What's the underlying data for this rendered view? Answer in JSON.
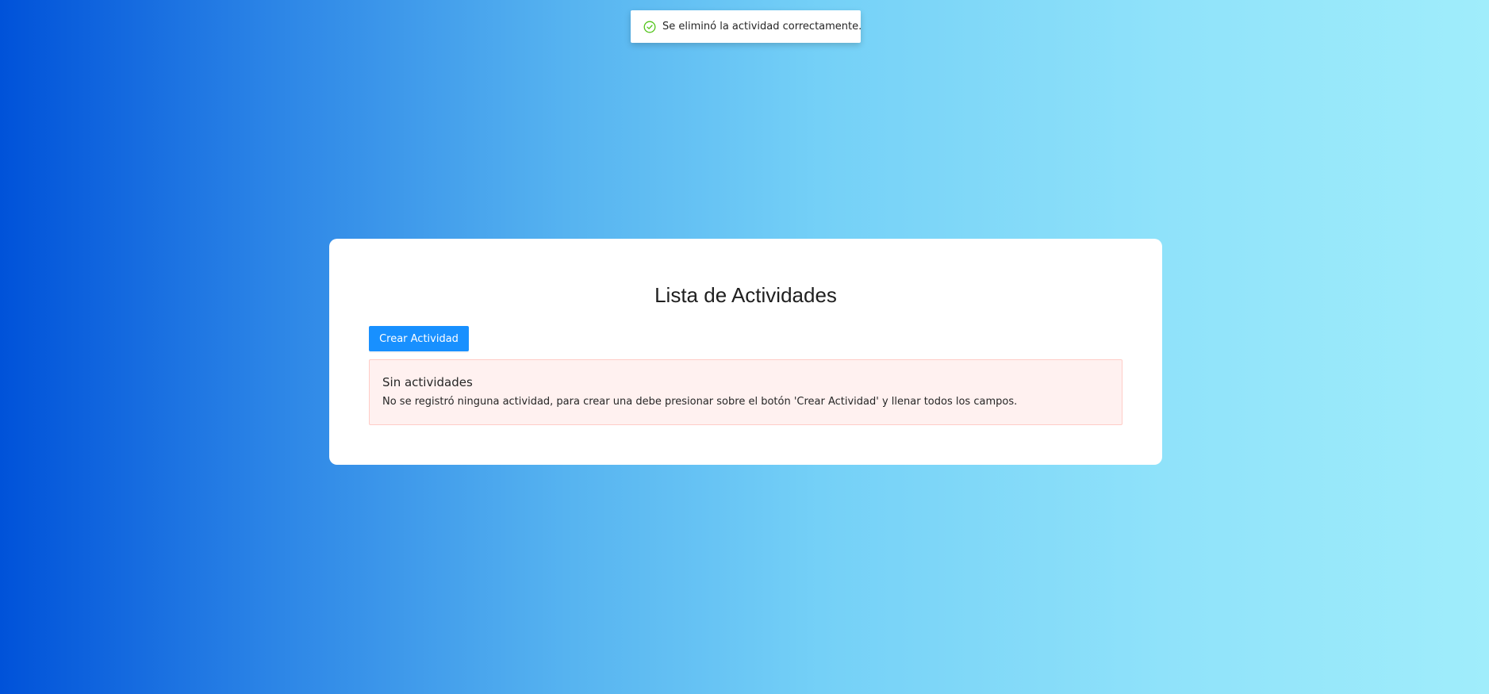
{
  "toast": {
    "icon": "check-circle-icon",
    "icon_color": "#52c41a",
    "message": "Se eliminó la actividad correctamente."
  },
  "card": {
    "title": "Lista de Actividades",
    "create_button_label": "Crear Actividad",
    "alert": {
      "title": "Sin actividades",
      "description": "No se registró ninguna actividad, para crear una debe presionar sobre el botón 'Crear Actividad' y llenar todos los campos."
    }
  },
  "colors": {
    "primary": "#1890ff",
    "alert_background": "#fff1f0",
    "alert_border": "#ffccc7",
    "gradient_start": "#0052d9",
    "gradient_end": "#a0edfb"
  }
}
